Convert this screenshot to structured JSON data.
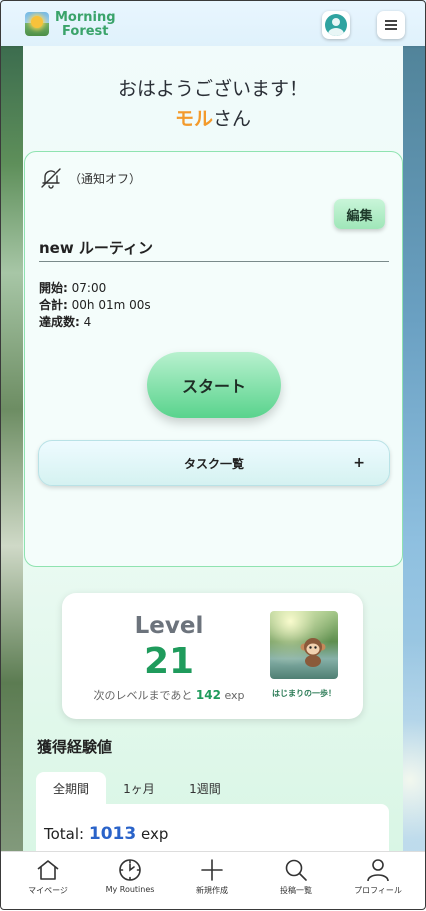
{
  "header": {
    "logo_line1": "Morning",
    "logo_line2": "Forest"
  },
  "greeting": {
    "line1": "おはようございます！",
    "name": "モル",
    "suffix": "さん"
  },
  "routine": {
    "notification_label": "（通知オフ）",
    "edit_label": "編集",
    "title": "new ルーティン",
    "start_label": "開始:",
    "start_value": "07:00",
    "total_label": "合計:",
    "total_value": "00h 01m 00s",
    "achieved_label": "達成数:",
    "achieved_value": "4",
    "start_button": "スタート",
    "task_list_label": "タスク一覧",
    "task_list_plus": "+"
  },
  "level": {
    "word": "Level",
    "value": "21",
    "next_prefix": "次のレベルまであと",
    "next_value": "142",
    "next_unit": "exp",
    "badge_caption": "はじまりの一歩！"
  },
  "experience": {
    "title": "獲得経験値",
    "tabs": [
      {
        "label": "全期間",
        "active": true
      },
      {
        "label": "1ヶ月",
        "active": false
      },
      {
        "label": "1週間",
        "active": false
      }
    ],
    "total_label": "Total:",
    "total_value": "1013",
    "total_unit": "exp"
  },
  "bottom_nav": [
    {
      "label": "マイページ",
      "icon": "home-icon"
    },
    {
      "label": "My Routines",
      "icon": "clock-icon"
    },
    {
      "label": "新規作成",
      "icon": "plus-icon"
    },
    {
      "label": "投稿一覧",
      "icon": "search-icon"
    },
    {
      "label": "プロフィール",
      "icon": "person-icon"
    }
  ],
  "colors": {
    "accent_green": "#1f9b5c",
    "name_orange": "#f39a2b",
    "total_blue": "#2a63c9"
  }
}
